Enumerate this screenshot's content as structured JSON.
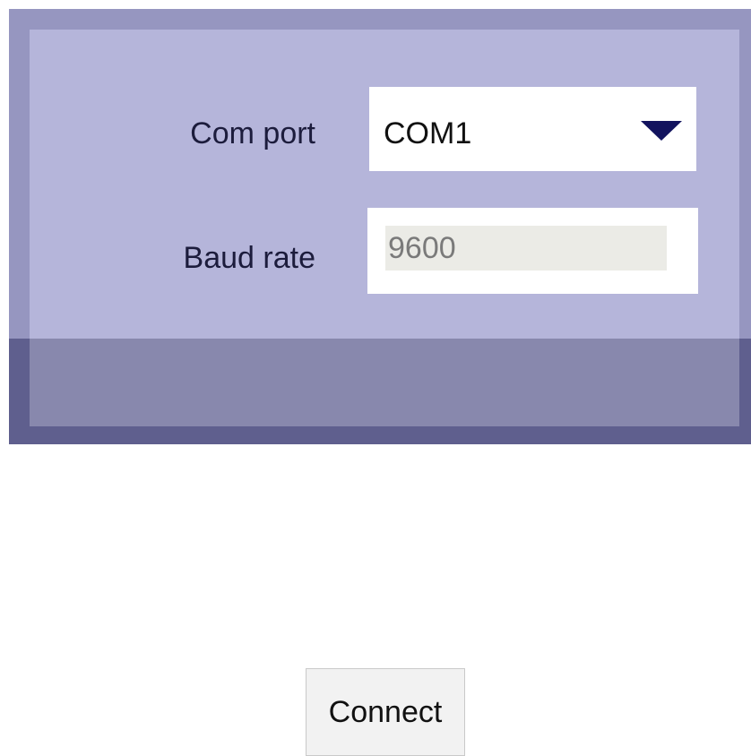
{
  "form": {
    "com_port_label": "Com port",
    "com_port_value": "COM1",
    "baud_rate_label": "Baud rate",
    "baud_rate_value": "9600"
  },
  "actions": {
    "connect_label": "Connect"
  },
  "icons": {
    "dropdown": "triangle-down-icon"
  },
  "colors": {
    "window_bg": "#9696c0",
    "panel_bg": "#b5b5da",
    "footer_bg": "#8888ad",
    "arrow": "#12135e",
    "input_bg": "#ebebe6"
  }
}
